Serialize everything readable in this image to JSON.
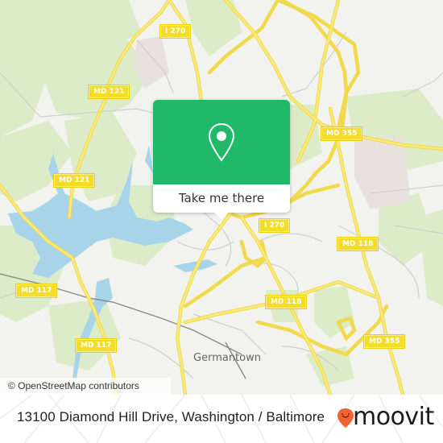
{
  "map": {
    "road_labels": [
      {
        "id": "i270-north",
        "text": "I 270"
      },
      {
        "id": "md121-north",
        "text": "MD 121"
      },
      {
        "id": "md121-south",
        "text": "MD 121"
      },
      {
        "id": "md355-north",
        "text": "MD 355"
      },
      {
        "id": "i270-south",
        "text": "I 270"
      },
      {
        "id": "md118-east",
        "text": "MD 118"
      },
      {
        "id": "md117-west",
        "text": "MD 117"
      },
      {
        "id": "md118-center",
        "text": "MD 118"
      },
      {
        "id": "md355-south",
        "text": "MD 355"
      },
      {
        "id": "md117-south",
        "text": "MD 117"
      }
    ],
    "place_labels": [
      {
        "id": "germantown",
        "text": "Germantown"
      }
    ],
    "attribution": "© OpenStreetMap contributors",
    "colors": {
      "background": "#f2f2ef",
      "park": "#d9ebc4",
      "water": "#a8d4ea",
      "road": "#f5e06b",
      "minor_road": "#c8c8c8"
    }
  },
  "popup": {
    "icon": "map-pin-icon",
    "button_label": "Take me there",
    "color": "#20b96a"
  },
  "footer": {
    "address": "13100 Diamond Hill Drive, Washington / Baltimore",
    "brand": "moovit",
    "brand_color": "#f26334"
  }
}
